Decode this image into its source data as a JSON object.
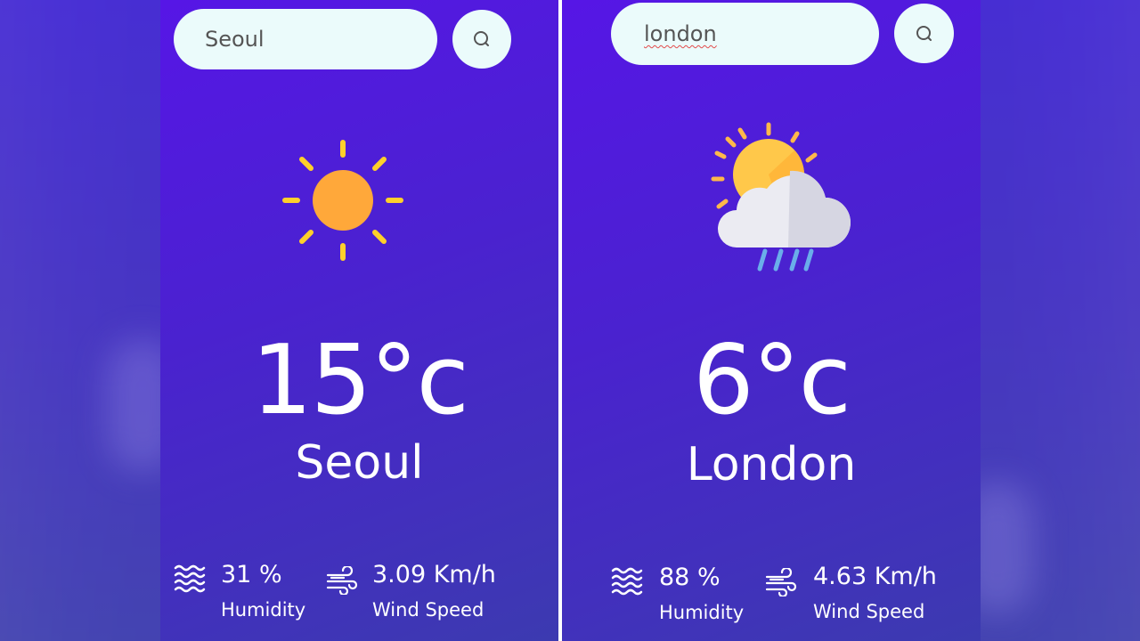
{
  "cards": [
    {
      "search": {
        "value": "Seoul"
      },
      "icon": "sun-icon",
      "temperature": "15°c",
      "city": "Seoul",
      "humidity": {
        "value": "31 %",
        "label": "Humidity"
      },
      "wind": {
        "value": "3.09 Km/h",
        "label": "Wind Speed"
      }
    },
    {
      "search": {
        "value": "london"
      },
      "icon": "sun-cloud-rain-icon",
      "temperature": "6°c",
      "city": "London",
      "humidity": {
        "value": "88 %",
        "label": "Humidity"
      },
      "wind": {
        "value": "4.63 Km/h",
        "label": "Wind Speed"
      }
    }
  ],
  "colors": {
    "background_top": "#5616e6",
    "background_bottom": "#3c3ab0",
    "search_bg": "#ebfbfb",
    "sun": "#ffa83a",
    "sun_rays": "#ffd02b",
    "cloud": "#ebebf2",
    "rain": "#6aaeea"
  }
}
